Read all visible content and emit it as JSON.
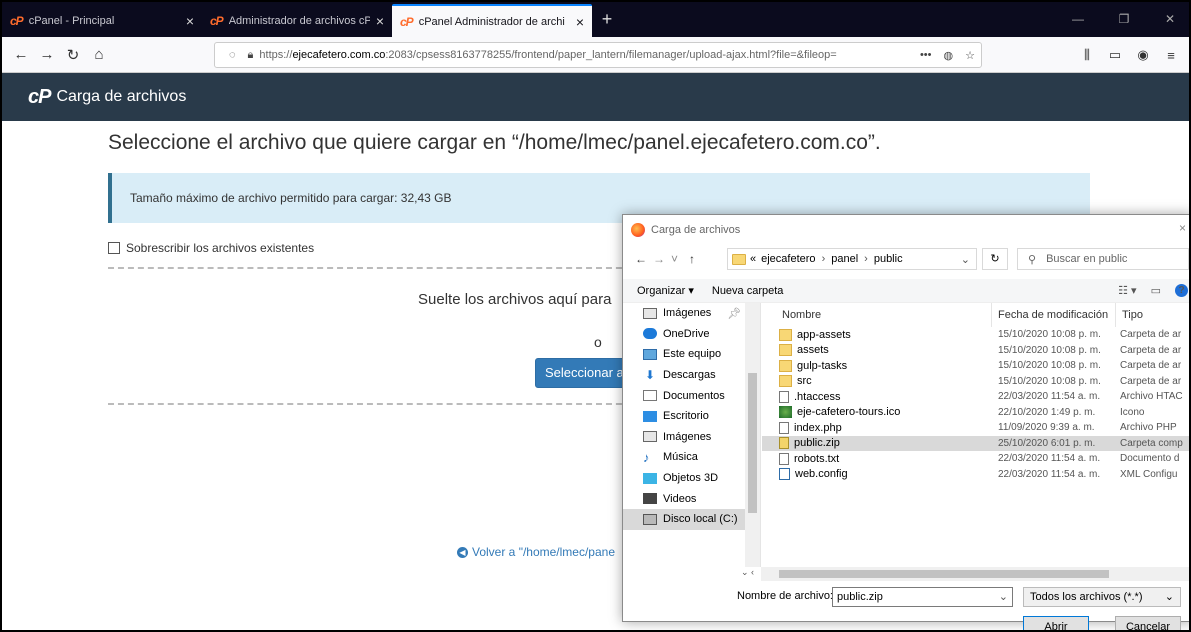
{
  "browser": {
    "tabs": [
      {
        "label": "cPanel - Principal",
        "active": false
      },
      {
        "label": "Administrador de archivos cPa",
        "active": false
      },
      {
        "label": "cPanel Administrador de archi",
        "active": true
      }
    ],
    "close_glyph": "×",
    "new_tab_glyph": "+",
    "url_prefix": "https://",
    "url_domain": "ejecafetero.com.co",
    "url_rest": ":2083/cpsess8163778255/frontend/paper_lantern/filemanager/upload-ajax.html?file=&fileop=",
    "url_more": "•••"
  },
  "header": {
    "logo": "cP",
    "title": "Carga de archivos"
  },
  "page": {
    "title": "Seleccione el archivo que quiere cargar en “/home/lmec/panel.ejecafetero.com.co”.",
    "alert": "Tamaño máximo de archivo permitido para cargar: 32,43 GB",
    "overwrite_label": "Sobrescribir los archivos existentes",
    "drop_text": "Suelte los archivos aquí para",
    "or_text": "o",
    "select_button": "Seleccionar ar",
    "back_link": "Volver a \"/home/lmec/pane"
  },
  "dialog": {
    "title": "Carga de archivos",
    "close": "×",
    "breadcrumb": {
      "prefix": "«",
      "items": [
        "ejecafetero",
        "panel",
        "public"
      ]
    },
    "search_placeholder": "Buscar en public",
    "toolbar": {
      "organize": "Organizar ▾",
      "new_folder": "Nueva carpeta"
    },
    "tree": [
      {
        "label": "Imágenes",
        "icon": "images-icon",
        "pinned": true
      },
      {
        "label": "OneDrive",
        "icon": "onedrive-icon"
      },
      {
        "label": "Este equipo",
        "icon": "computer-icon"
      },
      {
        "label": "Descargas",
        "icon": "downloads-icon"
      },
      {
        "label": "Documentos",
        "icon": "documents-icon"
      },
      {
        "label": "Escritorio",
        "icon": "desktop-icon"
      },
      {
        "label": "Imágenes",
        "icon": "images-icon"
      },
      {
        "label": "Música",
        "icon": "music-icon"
      },
      {
        "label": "Objetos 3D",
        "icon": "3d-objects-icon"
      },
      {
        "label": "Videos",
        "icon": "videos-icon"
      },
      {
        "label": "Disco local (C:)",
        "icon": "local-disk-icon",
        "selected": true
      }
    ],
    "columns": {
      "name": "Nombre",
      "modified": "Fecha de modificación",
      "type": "Tipo"
    },
    "files": [
      {
        "name": "app-assets",
        "date": "15/10/2020 10:08 p. m.",
        "type": "Carpeta de ar",
        "kind": "folder"
      },
      {
        "name": "assets",
        "date": "15/10/2020 10:08 p. m.",
        "type": "Carpeta de ar",
        "kind": "folder"
      },
      {
        "name": "gulp-tasks",
        "date": "15/10/2020 10:08 p. m.",
        "type": "Carpeta de ar",
        "kind": "folder"
      },
      {
        "name": "src",
        "date": "15/10/2020 10:08 p. m.",
        "type": "Carpeta de ar",
        "kind": "folder"
      },
      {
        "name": ".htaccess",
        "date": "22/03/2020 11:54 a. m.",
        "type": "Archivo HTAC",
        "kind": "file"
      },
      {
        "name": "eje-cafetero-tours.ico",
        "date": "22/10/2020 1:49 p. m.",
        "type": "Icono",
        "kind": "ico"
      },
      {
        "name": "index.php",
        "date": "11/09/2020 9:39 a. m.",
        "type": "Archivo PHP",
        "kind": "file"
      },
      {
        "name": "public.zip",
        "date": "25/10/2020 6:01 p. m.",
        "type": "Carpeta comp",
        "kind": "zip",
        "selected": true
      },
      {
        "name": "robots.txt",
        "date": "22/03/2020 11:54 a. m.",
        "type": "Documento d",
        "kind": "txt"
      },
      {
        "name": "web.config",
        "date": "22/03/2020 11:54 a. m.",
        "type": "XML Configu",
        "kind": "xml"
      }
    ],
    "filename_label": "Nombre de archivo:",
    "filename_value": "public.zip",
    "filetype_value": "Todos los archivos (*.*)",
    "open_button": "Abrir",
    "cancel_button": "Cancelar"
  },
  "colors": {
    "header_bg": "#293a4a",
    "alert_bg": "#d9edf7",
    "primary_button": "#337ab7",
    "cpanel_orange": "#ff6c2c"
  }
}
